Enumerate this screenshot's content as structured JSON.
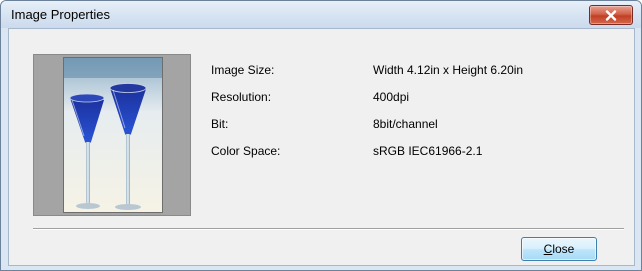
{
  "window": {
    "title": "Image Properties",
    "close_icon": "close-x-icon"
  },
  "preview": {
    "image": "blue-cocktail-glasses-photo"
  },
  "properties": [
    {
      "label": "Image Size:",
      "value": "Width 4.12in x Height 6.20in"
    },
    {
      "label": "Resolution:",
      "value": "400dpi"
    },
    {
      "label": "Bit:",
      "value": "8bit/channel"
    },
    {
      "label": "Color Space:",
      "value": "sRGB IEC61966-2.1"
    }
  ],
  "buttons": {
    "close_label": "Close",
    "close_accel": "C",
    "close_rest": "lose"
  },
  "colors": {
    "titlebar": "#d6e3f2",
    "close_x": "#c13f25",
    "button_focus_border": "#3c7fb1"
  }
}
